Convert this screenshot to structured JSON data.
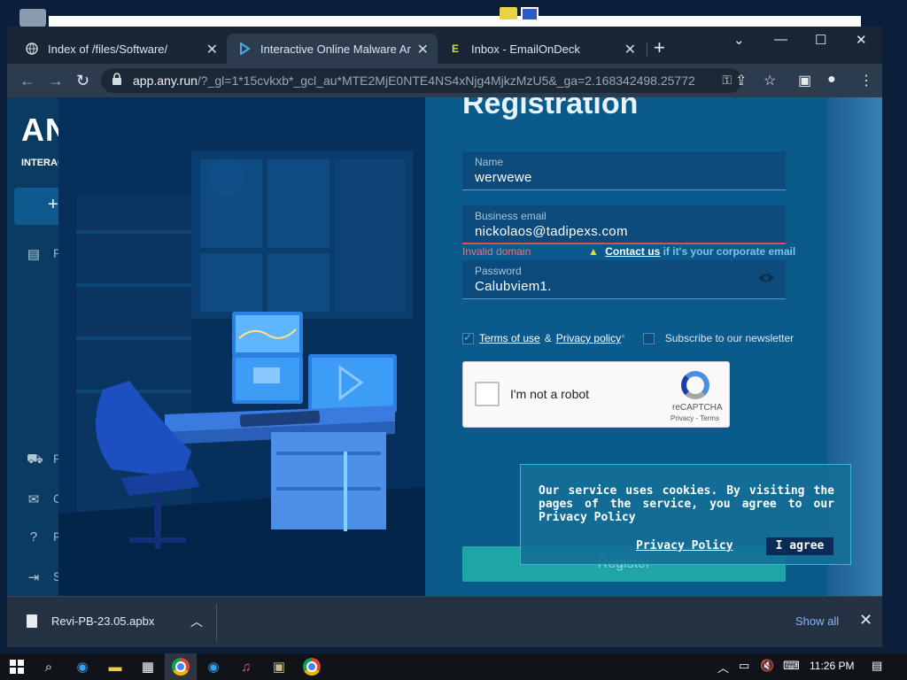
{
  "browser": {
    "tabs": [
      {
        "title": "Index of /files/Software/",
        "icon": "globe-icon"
      },
      {
        "title": "Interactive Online Malware Analy",
        "icon": "anyrun-icon"
      },
      {
        "title": "Inbox - EmailOnDeck",
        "icon": "emailondeck-icon"
      }
    ],
    "new_tab": "+",
    "url_host": "app.any.run",
    "url_rest": "/?_gl=1*15cvkxb*_gcl_au*MTE2MjE0NTE4NS4xNjg4MjkzMzU5&_ga=2.168342498.257721..."
  },
  "sidebar": {
    "brand": "ANY",
    "brand_sub": "INTERACT",
    "new_button": "+",
    "items": [
      {
        "label": "P",
        "icon": "document-icon"
      },
      {
        "label": "P",
        "icon": "cart-icon"
      },
      {
        "label": "C",
        "icon": "mail-icon"
      },
      {
        "label": "F",
        "icon": "help-icon"
      },
      {
        "label": "S",
        "icon": "sign-in-icon"
      }
    ]
  },
  "registration": {
    "title": "Registration",
    "name_label": "Name",
    "name_value": "werwewe",
    "email_label": "Business email",
    "email_value": "nickolaos@tadipexs.com",
    "error_text": "Invalid domain",
    "contact_link": "Contact us",
    "contact_suffix": "if it's your corporate email",
    "password_label": "Password",
    "password_value": "Calubviem1.",
    "terms_link": "Terms of use",
    "and_text": "&",
    "privacy_link": "Privacy policy",
    "required_mark": "*",
    "newsletter_label": "Subscribe to our newsletter",
    "register_button": "Register"
  },
  "recaptcha": {
    "label": "I'm not a robot",
    "brand": "reCAPTCHA",
    "links": "Privacy - Terms"
  },
  "cookie_banner": {
    "message": "Our service uses cookies. By visiting the pages of the service, you agree to our Privacy Policy",
    "policy_link": "Privacy Policy",
    "agree_button": "I agree"
  },
  "downloads": {
    "file_name": "Revi-PB-23.05.apbx",
    "show_all": "Show all"
  },
  "taskbar": {
    "time": "11:26 PM"
  },
  "colors": {
    "accent_teal": "#1fa5a5",
    "error_red": "#e04b5a",
    "panel_blue": "#0a5a8c"
  }
}
